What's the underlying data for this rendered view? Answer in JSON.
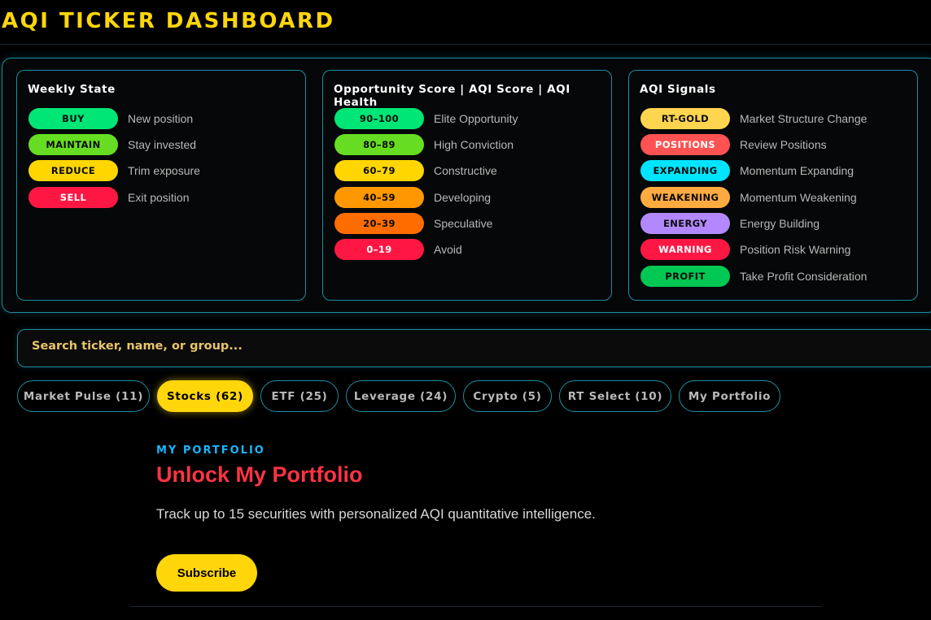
{
  "header": {
    "title": "AQI TICKER DASHBOARD"
  },
  "legend": {
    "weekly_state": {
      "title": "Weekly State",
      "items": [
        {
          "pill": "BUY",
          "label": "New position",
          "color": "#00e676",
          "text_color": "#0a0a0a"
        },
        {
          "pill": "MAINTAIN",
          "label": "Stay invested",
          "color": "#66dd22",
          "text_color": "#0a0a0a"
        },
        {
          "pill": "REDUCE",
          "label": "Trim exposure",
          "color": "#ffd600",
          "text_color": "#0a0a0a"
        },
        {
          "pill": "SELL",
          "label": "Exit position",
          "color": "#ff1744",
          "text_color": "#ffffff"
        }
      ]
    },
    "opportunity_score": {
      "title": "Opportunity Score | AQI Score | AQI Health",
      "items": [
        {
          "pill": "90–100",
          "label": "Elite Opportunity",
          "color": "#00e676",
          "text_color": "#0a0a0a"
        },
        {
          "pill": "80–89",
          "label": "High Conviction",
          "color": "#66dd22",
          "text_color": "#0a0a0a"
        },
        {
          "pill": "60–79",
          "label": "Constructive",
          "color": "#ffd600",
          "text_color": "#0a0a0a"
        },
        {
          "pill": "40–59",
          "label": "Developing",
          "color": "#ff9800",
          "text_color": "#0a0a0a"
        },
        {
          "pill": "20–39",
          "label": "Speculative",
          "color": "#ff6d00",
          "text_color": "#0a0a0a"
        },
        {
          "pill": "0–19",
          "label": "Avoid",
          "color": "#ff1744",
          "text_color": "#ffffff"
        }
      ]
    },
    "aqi_signals": {
      "title": "AQI Signals",
      "items": [
        {
          "pill": "RT-GOLD",
          "label": "Market Structure Change",
          "color": "#ffd54f",
          "text_color": "#0a0a0a"
        },
        {
          "pill": "POSITIONS",
          "label": "Review Positions",
          "color": "#ff5252",
          "text_color": "#ffffff"
        },
        {
          "pill": "EXPANDING",
          "label": "Momentum Expanding",
          "color": "#00e5ff",
          "text_color": "#0a0a0a"
        },
        {
          "pill": "WEAKENING",
          "label": "Momentum Weakening",
          "color": "#ffab40",
          "text_color": "#0a0a0a"
        },
        {
          "pill": "ENERGY",
          "label": "Energy Building",
          "color": "#b388ff",
          "text_color": "#0a0a0a"
        },
        {
          "pill": "WARNING",
          "label": "Position Risk Warning",
          "color": "#ff1744",
          "text_color": "#ffffff"
        },
        {
          "pill": "PROFIT",
          "label": "Take Profit Consideration",
          "color": "#00c853",
          "text_color": "#0a0a0a"
        }
      ]
    }
  },
  "search": {
    "placeholder": "Search ticker, name, or group...",
    "value": ""
  },
  "tabs": [
    {
      "label": "Market Pulse (11)",
      "active": false
    },
    {
      "label": "Stocks (62)",
      "active": true
    },
    {
      "label": "ETF (25)",
      "active": false
    },
    {
      "label": "Leverage (24)",
      "active": false
    },
    {
      "label": "Crypto (5)",
      "active": false
    },
    {
      "label": "RT Select (10)",
      "active": false
    },
    {
      "label": "My Portfolio",
      "active": false
    }
  ],
  "portfolio_promo": {
    "eyebrow": "MY PORTFOLIO",
    "title": "Unlock My Portfolio",
    "description": "Track up to 15 securities with personalized AQI quantitative intelligence.",
    "button_label": "Subscribe"
  },
  "colors": {
    "accent_yellow": "#ffd60a",
    "border_teal": "#1c8ea3",
    "eyebrow_blue": "#19b5ff",
    "title_red": "#ff3344"
  }
}
